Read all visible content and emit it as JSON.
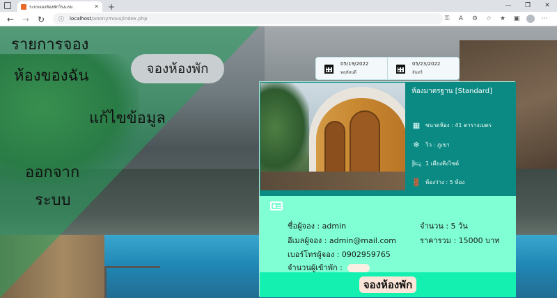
{
  "browser": {
    "tab_title": "ระบบจองห้องพักโรงแรม",
    "url_host": "localhost",
    "url_path": "/anonymous/index.php"
  },
  "sidebar": {
    "items": [
      {
        "label": "รายการจอง"
      },
      {
        "label": "ห้องของฉัน"
      },
      {
        "label": "จองห้องพัก"
      },
      {
        "label": "แก้ไขข้อมูล"
      },
      {
        "label": "ออกจาก"
      },
      {
        "label": "ระบบ"
      }
    ]
  },
  "dates": {
    "checkin": {
      "date": "05/19/2022",
      "weekday": "พฤหัสบดี"
    },
    "checkout": {
      "date": "05/23/2022",
      "weekday": "จันทร์"
    }
  },
  "room": {
    "name": "ห้องมาตรฐาน [Standard]",
    "size": "ขนาดห้อง : 41 ตารางเมตร",
    "view": "วิว : ภูเขา",
    "bed": "1 เตียงคิงไซต์",
    "available": "ห้องว่าง : 5 ห้อง"
  },
  "booking": {
    "booker_name": "ชื่อผู้จอง : admin",
    "booker_email": "อีเมลผู้จอง : admin@mail.com",
    "booker_phone": "เบอร์โทรผู้จอง : 0902959765",
    "guests_label": "จำนวนผู้เข้าพัก :",
    "nights": "จำนวน : 5 วัน",
    "total": "ราคารวม : 15000 บาท",
    "submit_label": "จองห้องพัก"
  },
  "colors": {
    "card_bg": "#7fffd3",
    "room_bg": "#0b8a84",
    "footer_bg": "#14f0b0",
    "sidebar_overlay": "#26a05f"
  }
}
